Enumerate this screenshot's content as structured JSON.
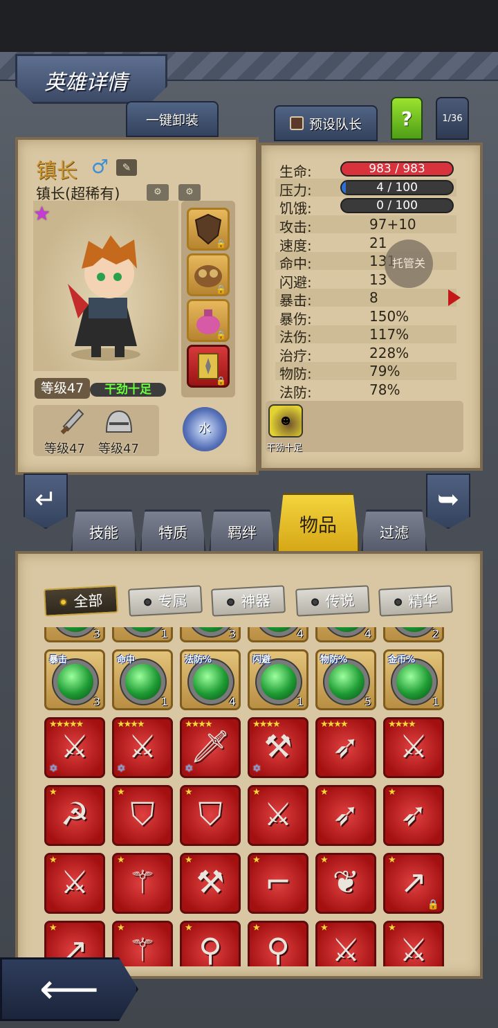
{
  "header": {
    "title": "英雄详情"
  },
  "top_buttons": {
    "unequip_all": "一键卸装",
    "preset_captain": "预设队长",
    "help": "?",
    "page_indicator": "1/36"
  },
  "hero": {
    "name": "镇长",
    "subtitle": "镇长(超稀有)",
    "gender_icon": "male-icon",
    "rarity_icon": "purple-star-icon",
    "level": "等级47",
    "status": "干劲十足",
    "weapon_level": "等级47",
    "armor_level": "等级47",
    "element": "水"
  },
  "stats": {
    "hp": {
      "label": "生命:",
      "value": "983 / 983",
      "fill": 1.0
    },
    "stress": {
      "label": "压力:",
      "value": "4 / 100",
      "fill": 0.04
    },
    "hunger": {
      "label": "饥饿:",
      "value": "0 / 100",
      "fill": 0.0
    },
    "rows": [
      {
        "label": "攻击:",
        "value": "97+10"
      },
      {
        "label": "速度:",
        "value": "21"
      },
      {
        "label": "命中:",
        "value": "131"
      },
      {
        "label": "闪避:",
        "value": "13"
      },
      {
        "label": "暴击:",
        "value": "8"
      },
      {
        "label": "暴伤:",
        "value": "150%"
      },
      {
        "label": "法伤:",
        "value": "117%"
      },
      {
        "label": "治疗:",
        "value": "228%"
      },
      {
        "label": "物防:",
        "value": "79%"
      },
      {
        "label": "法防:",
        "value": "78%"
      }
    ],
    "auto_button": "托管关"
  },
  "trait": {
    "label": "干劲十足"
  },
  "tabs": [
    "技能",
    "特质",
    "羁绊",
    "物品",
    "过滤"
  ],
  "active_tab": "物品",
  "filters": [
    "全部",
    "专属",
    "神器",
    "传说",
    "精华"
  ],
  "active_filter": "全部",
  "inventory": {
    "partial_row_counts": [
      "3",
      "1",
      "3",
      "4",
      "4",
      "2"
    ],
    "gem_row": [
      {
        "label": "暴击",
        "count": "3"
      },
      {
        "label": "命中",
        "count": "1"
      },
      {
        "label": "法防%",
        "count": "4"
      },
      {
        "label": "闪避",
        "count": "1"
      },
      {
        "label": "物防%",
        "count": "5"
      },
      {
        "label": "金币%",
        "count": "1"
      }
    ],
    "weapon_rows": [
      [
        {
          "icon": "crossbow-icon",
          "stars": 5,
          "tier": true
        },
        {
          "icon": "scimitar-icon",
          "stars": 4,
          "tier": true
        },
        {
          "icon": "dagger-icon",
          "stars": 4,
          "tier": true
        },
        {
          "icon": "battle-axe-icon",
          "stars": 4,
          "tier": true
        },
        {
          "icon": "bow-icon",
          "stars": 4,
          "tier": false
        },
        {
          "icon": "broadsword-icon",
          "stars": 4,
          "tier": false
        }
      ],
      [
        {
          "icon": "scythe-icon",
          "stars": 1,
          "tier": false
        },
        {
          "icon": "shield-icon",
          "stars": 1,
          "tier": false
        },
        {
          "icon": "shield-icon",
          "stars": 1,
          "tier": false
        },
        {
          "icon": "crossed-swords-icon",
          "stars": 1,
          "tier": false
        },
        {
          "icon": "bow-icon",
          "stars": 1,
          "tier": false
        },
        {
          "icon": "bow-icon",
          "stars": 1,
          "tier": false
        }
      ],
      [
        {
          "icon": "crossbow-icon",
          "stars": 1,
          "tier": false
        },
        {
          "icon": "staff-icon",
          "stars": 1,
          "tier": false
        },
        {
          "icon": "double-axe-icon",
          "stars": 1,
          "tier": false
        },
        {
          "icon": "rifle-icon",
          "stars": 1,
          "tier": false
        },
        {
          "icon": "feather-fan-icon",
          "stars": 1,
          "tier": false
        },
        {
          "icon": "spear-icon",
          "stars": 1,
          "tier": false,
          "locked": true
        }
      ],
      [
        {
          "icon": "spear-icon",
          "stars": 1,
          "tier": false
        },
        {
          "icon": "dark-staff-icon",
          "stars": 1,
          "tier": false
        },
        {
          "icon": "orb-staff-icon",
          "stars": 1,
          "tier": false
        },
        {
          "icon": "orb-staff-icon",
          "stars": 1,
          "tier": false
        },
        {
          "icon": "cleaver-icon",
          "stars": 1,
          "tier": false
        },
        {
          "icon": "broadsword-icon",
          "stars": 1,
          "tier": false
        }
      ]
    ]
  },
  "colors": {
    "hp_bar": "#d8323c",
    "stress_bar": "#2d6fd3",
    "active_tab": "#e6bd28",
    "item_bg": "#c0181c"
  }
}
